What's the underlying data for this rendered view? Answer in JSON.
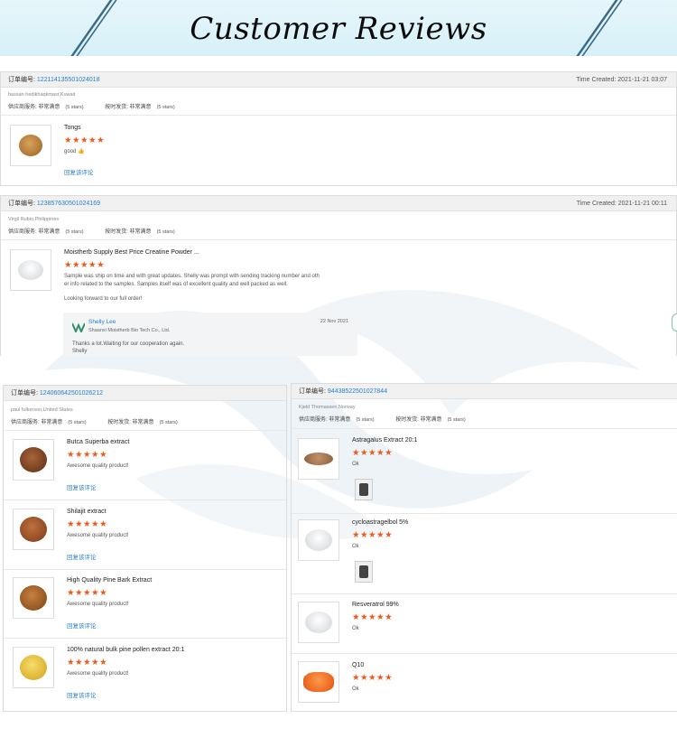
{
  "banner": {
    "title": "Customer Reviews"
  },
  "labels": {
    "order": "订单编号:",
    "time": "Time Created:",
    "svc_supplier": "供应商服务:",
    "svc_ship": "按时发货:",
    "rating_text": "非常满意",
    "rating_stars": "(5 stars)",
    "reply_link": "回复该评论"
  },
  "stars": "★★★★★",
  "reviews": [
    {
      "order_no": "122114135501024018",
      "time": "2021-11-21 03:07",
      "buyer": "hassan hedikhaqkmasr,Kuwait",
      "items": [
        {
          "name": "Tongs",
          "text": "good 👍",
          "link": "回复该评论"
        }
      ]
    },
    {
      "order_no": "123857630501024169",
      "time": "2021-11-21 00:11",
      "buyer": "Virgil Rubio,Philippines",
      "items": [
        {
          "name": "Moistherb Supply Best Price Creatine Powder ...",
          "text1": "Sample was ship on time and with great updates. Shelly was prompt with sending tracking number and oth",
          "text2": "er info related to the samples. Samples itself was of excellent quality and well packed as well.",
          "text3": "Looking forward to our full order!"
        }
      ],
      "reply": {
        "name": "Shelly Lee",
        "company": "Shaanxi Moistherb Bio Tech Co., Ltd.",
        "date": "22 Nov 2021",
        "msg1": "Thanks a lot.Waiting for our cooperation again.",
        "msg2": "Shelly"
      }
    },
    {
      "order_no": "124060642501026212",
      "buyer": "paul fulkerson,United States",
      "items": [
        {
          "name": "Butca Superba extract",
          "text": "Awesome quality product!",
          "link": "回复该评论"
        },
        {
          "name": "Shilajit extract",
          "text": "Awesome quality product!",
          "link": "回复该评论"
        },
        {
          "name": "High Quality Pine Bark Extract",
          "text": "Awesome quality product!",
          "link": "回复该评论"
        },
        {
          "name": "100% natural bulk pine pollen extract 20:1",
          "text": "Awesome quality product!",
          "link": "回复该评论"
        }
      ]
    },
    {
      "order_no": "94438522501027844",
      "buyer": "Kjeld Thomassen,Norway",
      "items": [
        {
          "name": "Astragalus Extract 20:1",
          "text": "Ok"
        },
        {
          "name": "cycloastragelbol 5%",
          "text": "Ok"
        },
        {
          "name": "Resveratrol 99%",
          "text": "Ok"
        },
        {
          "name": "Q10",
          "text": "Ok"
        }
      ]
    }
  ],
  "colors": {
    "star": "#ea5a1a",
    "link": "#2a7ec9",
    "banner": "#d7f0f8"
  }
}
